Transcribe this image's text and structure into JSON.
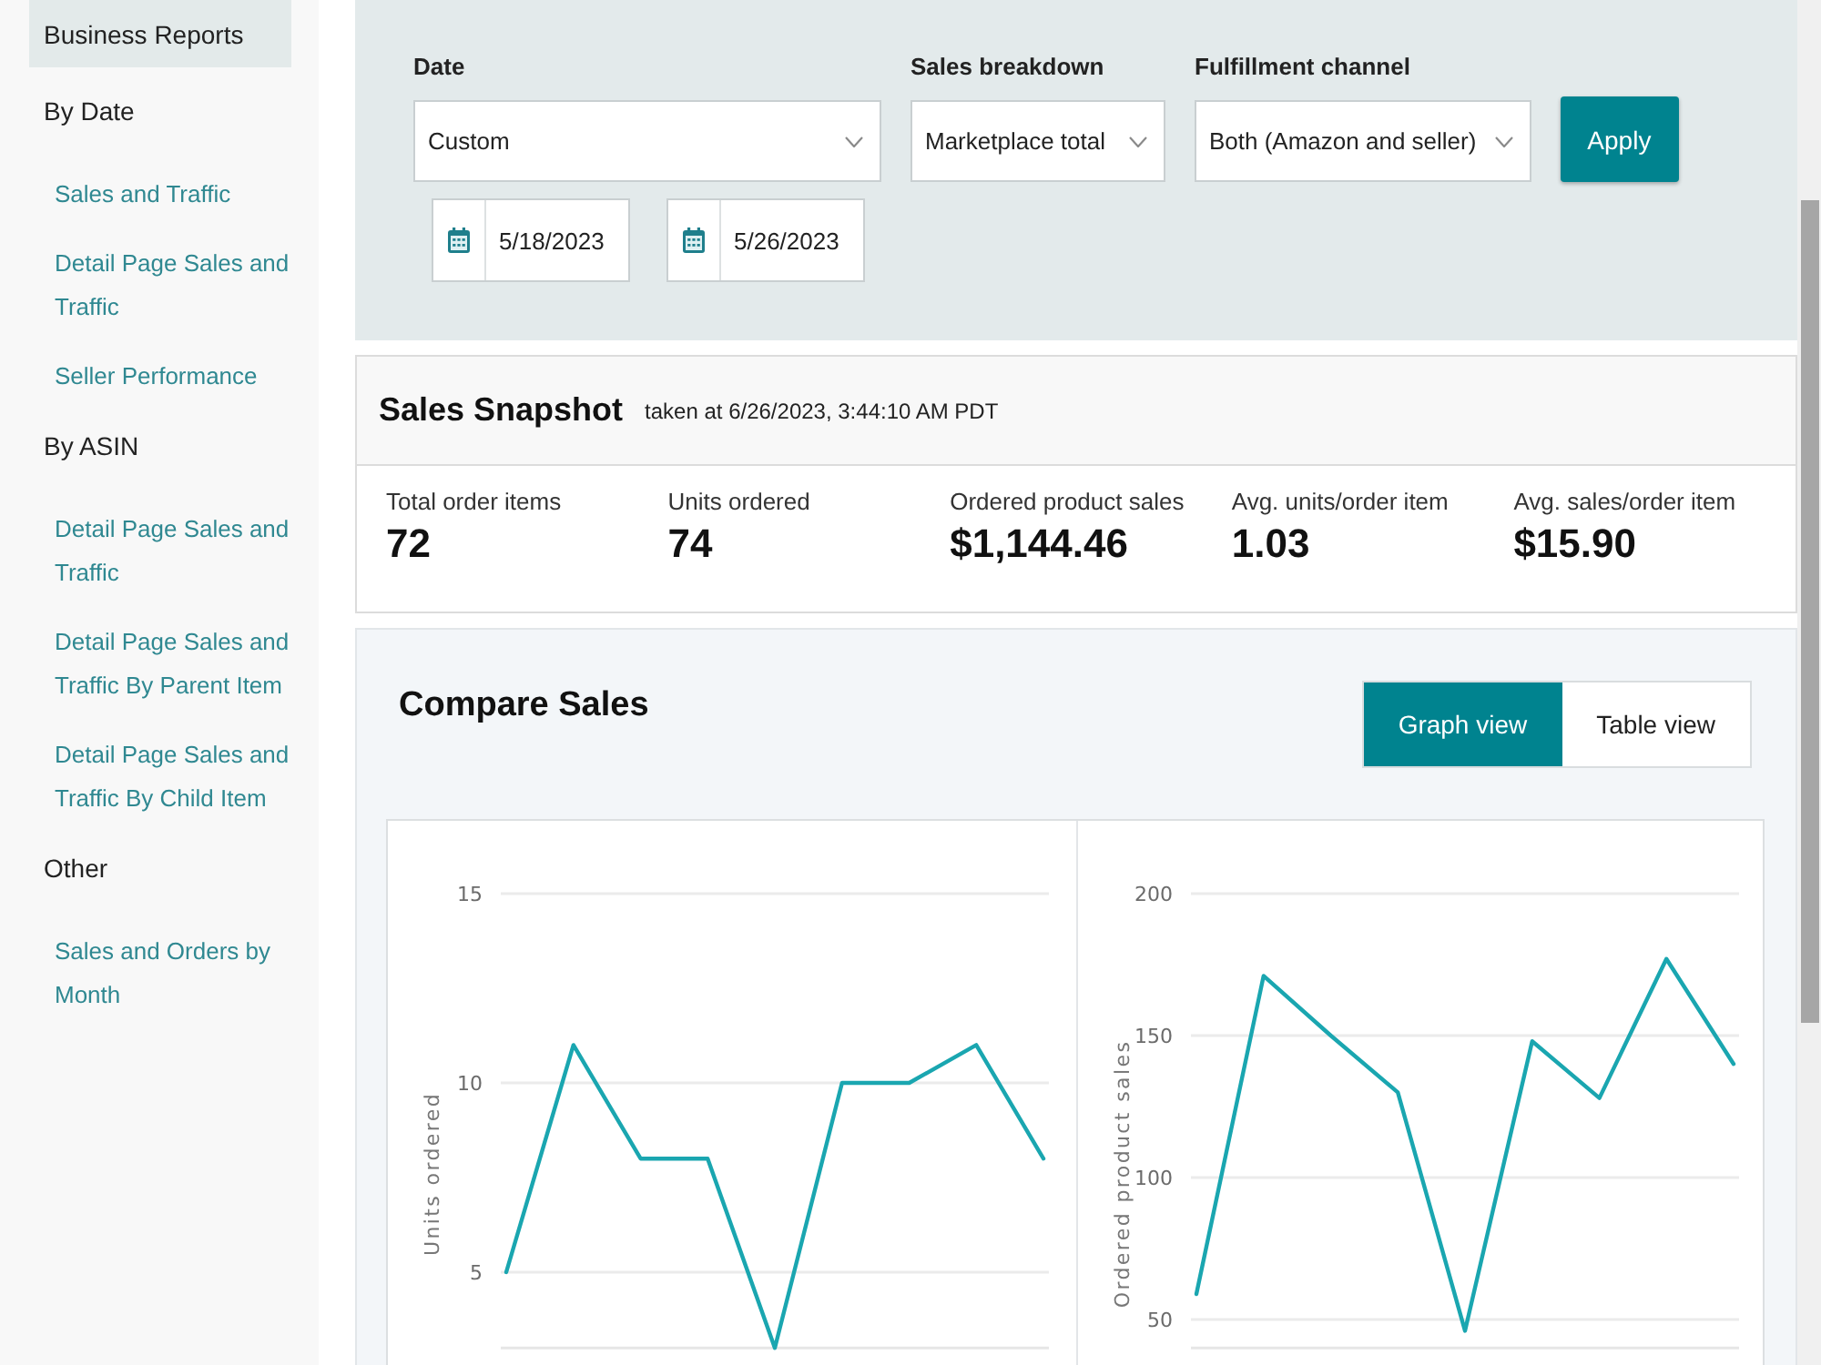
{
  "sidebar": {
    "header": "Business Reports",
    "sections": [
      {
        "title": "By Date",
        "items": [
          {
            "label": "Sales and Traffic"
          },
          {
            "label": "Detail Page Sales and Traffic"
          },
          {
            "label": "Seller Performance"
          }
        ]
      },
      {
        "title": "By ASIN",
        "items": [
          {
            "label": "Detail Page Sales and Traffic"
          },
          {
            "label": "Detail Page Sales and Traffic By Parent Item"
          },
          {
            "label": "Detail Page Sales and Traffic By Child Item"
          }
        ]
      },
      {
        "title": "Other",
        "items": [
          {
            "label": "Sales and Orders by Month"
          }
        ]
      }
    ]
  },
  "filters": {
    "fields": [
      {
        "label": "Date",
        "value": "Custom"
      },
      {
        "label": "Sales breakdown",
        "value": "Marketplace total"
      },
      {
        "label": "Fulfillment channel",
        "value": "Both (Amazon and seller)"
      }
    ],
    "date_range": [
      "5/18/2023",
      "5/26/2023"
    ],
    "apply_button": "Apply"
  },
  "snapshot": {
    "title": "Sales Snapshot",
    "taken_at": "taken at 6/26/2023, 3:44:10 AM PDT",
    "metrics": [
      {
        "label": "Total order items",
        "value": "72"
      },
      {
        "label": "Units ordered",
        "value": "74"
      },
      {
        "label": "Ordered product sales",
        "value": "$1,144.46"
      },
      {
        "label": "Avg. units/order item",
        "value": "1.03"
      },
      {
        "label": "Avg. sales/order item",
        "value": "$15.90"
      }
    ]
  },
  "compare_sales": {
    "title": "Compare Sales",
    "views": [
      {
        "label": "Graph view",
        "selected": true
      },
      {
        "label": "Table view",
        "selected": false
      }
    ],
    "charts": [
      {
        "chart_data": {
          "type": "line",
          "ylabel": "Units ordered",
          "ylim": [
            3,
            15
          ],
          "yticks": [
            5,
            10,
            15
          ],
          "grid": true,
          "values": [
            5,
            11,
            8,
            8,
            3,
            10,
            10,
            11,
            8
          ]
        }
      },
      {
        "chart_data": {
          "type": "line",
          "ylabel": "Ordered product sales",
          "ylim": [
            40,
            200
          ],
          "yticks": [
            50,
            100,
            150,
            200
          ],
          "grid": true,
          "values": [
            59,
            171,
            150,
            130,
            46,
            148,
            128,
            177,
            140
          ]
        }
      }
    ]
  }
}
